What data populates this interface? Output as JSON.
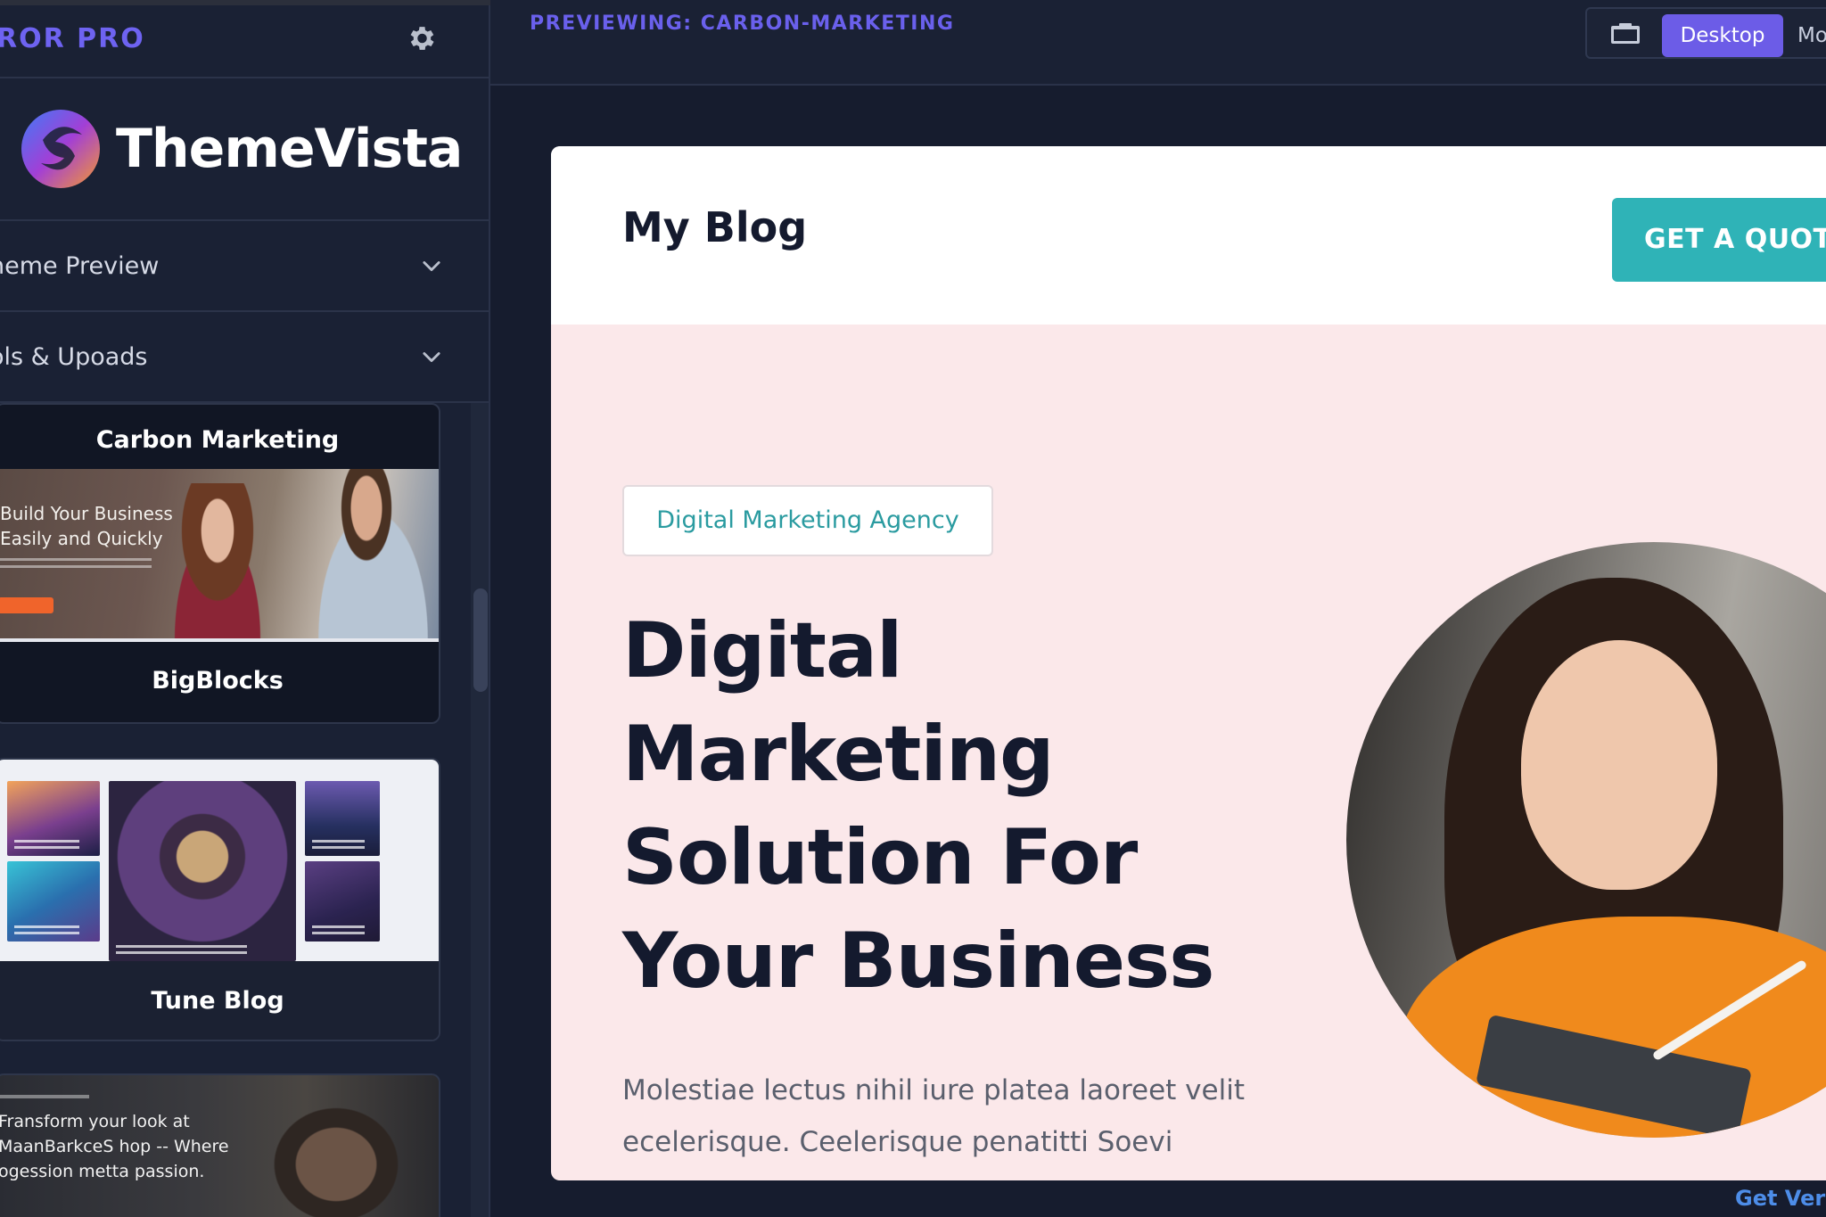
{
  "sidebar": {
    "app_name": "ROR PRO",
    "logo_text": "ThemeVista",
    "accordions": [
      {
        "label": "heme Preview"
      },
      {
        "label": "ols & Upoads"
      }
    ],
    "themes": [
      {
        "name": "Carbon Marketing",
        "preview_text_line1": "Build Your Business",
        "preview_text_line2": "Easily and Quickly",
        "footer_label": "BigBlocks"
      },
      {
        "name": "Tune Blog"
      },
      {
        "preview_text_line1": "Fransform your look at",
        "preview_text_line2": "MaanBarkceS hop -- Where",
        "preview_text_line3": "ogession metta passion."
      }
    ]
  },
  "topbar": {
    "previewing": "PREVIEWING: CARBON-MARKETING",
    "desktop_label": "Desktop",
    "mobile_label": "Mo"
  },
  "preview": {
    "site_title": "My Blog",
    "quote_button": "GET A QUOTE",
    "badge": "Digital Marketing Agency",
    "hero_lines": [
      "Digital",
      "Marketing",
      "Solution For",
      "Your Business"
    ],
    "hero_text_line1": "Molestiae lectus nihil iure platea laoreet velit",
    "hero_text_line2": "ecelerisque. Ceelerisque penatitti Soevi"
  },
  "footer_link": "Get Vers",
  "colors": {
    "accent": "#6c5ce7",
    "teal": "#2fb3b7",
    "sidebar_bg": "#1a2134",
    "hero_bg": "#fbe8ea"
  },
  "icons": {
    "settings": "gear-icon",
    "accordion": "chevron-down-icon",
    "device": "tablet-icon"
  }
}
